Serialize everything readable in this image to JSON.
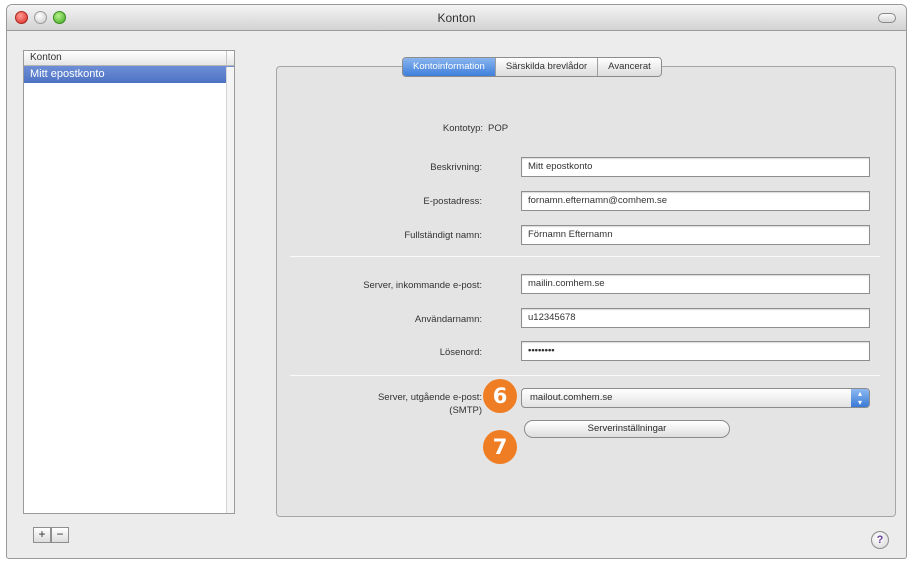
{
  "window": {
    "title": "Konton"
  },
  "sidebar": {
    "header": "Konton",
    "items": [
      {
        "label": "Mitt epostkonto",
        "selected": true
      }
    ],
    "add_label": "+",
    "remove_label": "−"
  },
  "tabs": [
    {
      "label": "Kontoinformation",
      "active": true
    },
    {
      "label": "Särskilda brevlådor",
      "active": false
    },
    {
      "label": "Avancerat",
      "active": false
    }
  ],
  "account": {
    "type_label": "Kontotyp:",
    "type_value": "POP",
    "description_label": "Beskrivning:",
    "description_value": "Mitt epostkonto",
    "email_label": "E-postadress:",
    "email_value": "fornamn.efternamn@comhem.se",
    "fullname_label": "Fullständigt namn:",
    "fullname_value": "Förnamn Efternamn",
    "incoming_label": "Server, inkommande e-post:",
    "incoming_value": "mailin.comhem.se",
    "username_label": "Användarnamn:",
    "username_value": "u12345678",
    "password_label": "Lösenord:",
    "password_value": "••••••••",
    "outgoing_label": "Server, utgående e-post:",
    "outgoing_sub": "(SMTP)",
    "outgoing_value": "mailout.comhem.se",
    "server_settings_button": "Serverinställningar"
  },
  "annotations": {
    "marker_6": "6",
    "marker_7": "7"
  },
  "help_label": "?",
  "colors": {
    "badge": "#ee7d23",
    "selection": "#4d72c4",
    "tab_active": "#3f7fdb"
  }
}
